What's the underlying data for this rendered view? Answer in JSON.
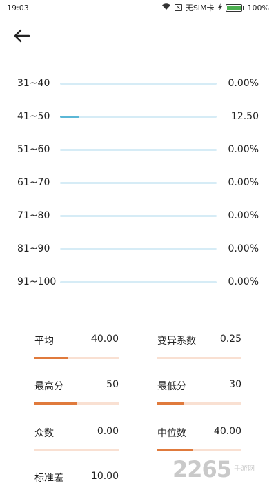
{
  "status_bar": {
    "time": "19:03",
    "carrier": "无SIM卡",
    "battery": "100%"
  },
  "distribution": [
    {
      "range": "31~40",
      "value": "0.00%",
      "fraction": 0
    },
    {
      "range": "41~50",
      "value": "12.50",
      "fraction": 0.125
    },
    {
      "range": "51~60",
      "value": "0.00%",
      "fraction": 0
    },
    {
      "range": "61~70",
      "value": "0.00%",
      "fraction": 0
    },
    {
      "range": "71~80",
      "value": "0.00%",
      "fraction": 0
    },
    {
      "range": "81~90",
      "value": "0.00%",
      "fraction": 0
    },
    {
      "range": "91~100",
      "value": "0.00%",
      "fraction": 0
    }
  ],
  "stats": [
    {
      "label": "平均",
      "value": "40.00",
      "fraction": 0.4
    },
    {
      "label": "变异系数",
      "value": "0.25",
      "fraction": 0
    },
    {
      "label": "最高分",
      "value": "50",
      "fraction": 0.5
    },
    {
      "label": "最低分",
      "value": "30",
      "fraction": 0.32
    },
    {
      "label": "众数",
      "value": "0.00",
      "fraction": 0
    },
    {
      "label": "中位数",
      "value": "40.00",
      "fraction": 0.42
    },
    {
      "label": "标准差",
      "value": "10.00",
      "fraction": 0
    }
  ],
  "watermark": {
    "digits": "2265",
    "text": "手游网"
  },
  "colors": {
    "dist_track": "#d6ecf6",
    "dist_fill": "#5bb7d6",
    "stat_track": "#f9e0d2",
    "stat_fill": "#e07a3c"
  }
}
